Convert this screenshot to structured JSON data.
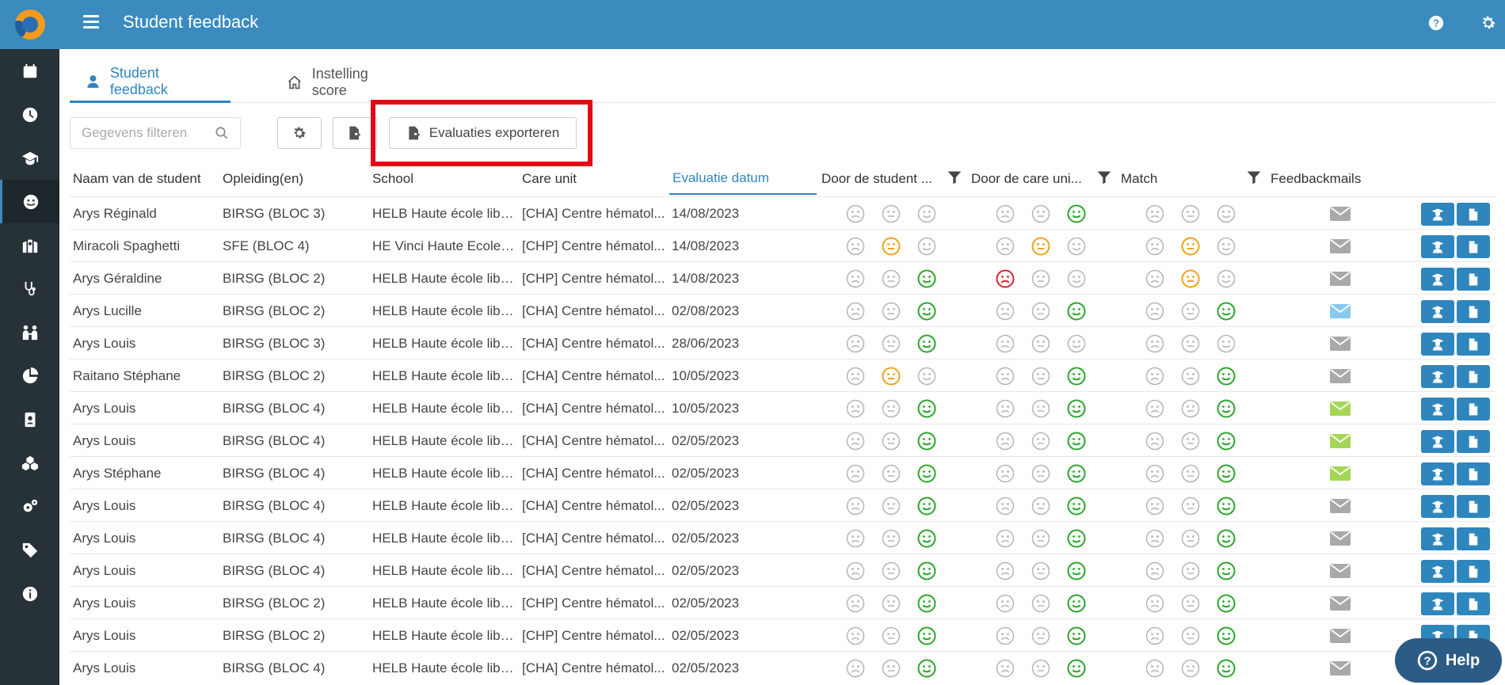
{
  "app": {
    "title": "Student feedback"
  },
  "colors": {
    "brand": "#3b8bbf",
    "sidebar": "#263238",
    "accent": "#2f86bd",
    "happy": "#2aa52a",
    "neutral_active": "#f0a319",
    "sad_active": "#d9252b",
    "inactive": "#b5b5b5",
    "mail_gray": "#a9a9a9",
    "mail_blue": "#89c8ef",
    "mail_green": "#a5d656",
    "highlight": "#e30613"
  },
  "sidebar": {
    "items": [
      {
        "icon": "calendar-icon"
      },
      {
        "icon": "clock-icon"
      },
      {
        "icon": "graduation-cap-icon"
      },
      {
        "icon": "smiley-icon",
        "active": true
      },
      {
        "icon": "hospital-icon"
      },
      {
        "icon": "stethoscope-icon"
      },
      {
        "icon": "people-icon"
      },
      {
        "icon": "pie-chart-icon"
      },
      {
        "icon": "id-badge-icon"
      },
      {
        "icon": "cubes-icon"
      },
      {
        "icon": "cogs-icon"
      },
      {
        "icon": "tags-icon"
      },
      {
        "icon": "info-icon"
      }
    ]
  },
  "tabs": [
    {
      "label": "Student feedback",
      "icon": "user-icon",
      "active": true
    },
    {
      "label": "Instelling score",
      "icon": "home-icon",
      "active": false
    }
  ],
  "toolbar": {
    "search_placeholder": "Gegevens filteren",
    "export_label": "Evaluaties exporteren"
  },
  "columns": {
    "student": "Naam van de student",
    "opleiding": "Opleiding(en)",
    "school": "School",
    "care_unit": "Care unit",
    "evaluatie_datum": "Evaluatie datum",
    "door_student": "Door de student ...",
    "door_care_unit": "Door de care uni...",
    "match": "Match",
    "feedbackmails": "Feedbackmails"
  },
  "rows": [
    {
      "student": "Arys Réginald",
      "opleiding": "BIRSG (BLOC 3)",
      "school": "HELB Haute école libr...",
      "care_unit": "[CHA] Centre hématol...",
      "date": "14/08/2023",
      "by_student": "none",
      "by_care": "happy",
      "match": "none",
      "mail": "gray"
    },
    {
      "student": "Miracoli Spaghetti",
      "opleiding": "SFE (BLOC 4)",
      "school": "HE Vinci Haute Ecole ...",
      "care_unit": "[CHP] Centre hématol...",
      "date": "14/08/2023",
      "by_student": "neutral",
      "by_care": "neutral",
      "match": "neutral",
      "mail": "gray"
    },
    {
      "student": "Arys Géraldine",
      "opleiding": "BIRSG (BLOC 2)",
      "school": "HELB Haute école libr...",
      "care_unit": "[CHP] Centre hématol...",
      "date": "14/08/2023",
      "by_student": "happy",
      "by_care": "sad",
      "match": "neutral",
      "mail": "gray"
    },
    {
      "student": "Arys Lucille",
      "opleiding": "BIRSG (BLOC 2)",
      "school": "HELB Haute école libr...",
      "care_unit": "[CHA] Centre hématol...",
      "date": "02/08/2023",
      "by_student": "happy",
      "by_care": "happy",
      "match": "happy",
      "mail": "blue"
    },
    {
      "student": "Arys Louis",
      "opleiding": "BIRSG (BLOC 3)",
      "school": "HELB Haute école libr...",
      "care_unit": "[CHA] Centre hématol...",
      "date": "28/06/2023",
      "by_student": "happy",
      "by_care": "none",
      "match": "none",
      "mail": "gray"
    },
    {
      "student": "Raitano Stéphane",
      "opleiding": "BIRSG (BLOC 2)",
      "school": "HELB Haute école libr...",
      "care_unit": "[CHA] Centre hématol...",
      "date": "10/05/2023",
      "by_student": "neutral",
      "by_care": "happy",
      "match": "happy",
      "mail": "gray"
    },
    {
      "student": "Arys Louis",
      "opleiding": "BIRSG (BLOC 4)",
      "school": "HELB Haute école libr...",
      "care_unit": "[CHA] Centre hématol...",
      "date": "10/05/2023",
      "by_student": "happy",
      "by_care": "happy",
      "match": "happy",
      "mail": "green"
    },
    {
      "student": "Arys Louis",
      "opleiding": "BIRSG (BLOC 4)",
      "school": "HELB Haute école libr...",
      "care_unit": "[CHA] Centre hématol...",
      "date": "02/05/2023",
      "by_student": "happy",
      "by_care": "happy",
      "match": "happy",
      "mail": "green"
    },
    {
      "student": "Arys Stéphane",
      "opleiding": "BIRSG (BLOC 4)",
      "school": "HELB Haute école libr...",
      "care_unit": "[CHA] Centre hématol...",
      "date": "02/05/2023",
      "by_student": "happy",
      "by_care": "happy",
      "match": "happy",
      "mail": "green"
    },
    {
      "student": "Arys Louis",
      "opleiding": "BIRSG (BLOC 4)",
      "school": "HELB Haute école libr...",
      "care_unit": "[CHA] Centre hématol...",
      "date": "02/05/2023",
      "by_student": "happy",
      "by_care": "happy",
      "match": "happy",
      "mail": "gray"
    },
    {
      "student": "Arys Louis",
      "opleiding": "BIRSG (BLOC 4)",
      "school": "HELB Haute école libr...",
      "care_unit": "[CHA] Centre hématol...",
      "date": "02/05/2023",
      "by_student": "happy",
      "by_care": "happy",
      "match": "happy",
      "mail": "gray"
    },
    {
      "student": "Arys Louis",
      "opleiding": "BIRSG (BLOC 4)",
      "school": "HELB Haute école libr...",
      "care_unit": "[CHA] Centre hématol...",
      "date": "02/05/2023",
      "by_student": "happy",
      "by_care": "happy",
      "match": "happy",
      "mail": "gray"
    },
    {
      "student": "Arys Louis",
      "opleiding": "BIRSG (BLOC 2)",
      "school": "HELB Haute école libr...",
      "care_unit": "[CHP] Centre hématol...",
      "date": "02/05/2023",
      "by_student": "happy",
      "by_care": "happy",
      "match": "happy",
      "mail": "gray"
    },
    {
      "student": "Arys Louis",
      "opleiding": "BIRSG (BLOC 2)",
      "school": "HELB Haute école libr...",
      "care_unit": "[CHP] Centre hématol...",
      "date": "02/05/2023",
      "by_student": "happy",
      "by_care": "happy",
      "match": "happy",
      "mail": "gray"
    },
    {
      "student": "Arys Louis",
      "opleiding": "BIRSG (BLOC 4)",
      "school": "HELB Haute école libr...",
      "care_unit": "[CHA] Centre hématol...",
      "date": "02/05/2023",
      "by_student": "happy",
      "by_care": "happy",
      "match": "happy",
      "mail": "gray"
    }
  ],
  "help": {
    "label": "Help"
  }
}
